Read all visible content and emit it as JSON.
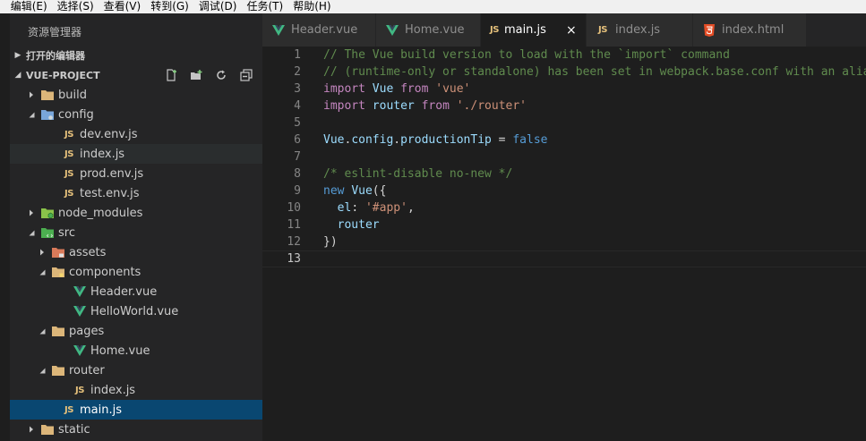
{
  "menu": {
    "items": [
      "编辑(E)",
      "选择(S)",
      "查看(V)",
      "转到(G)",
      "调试(D)",
      "任务(T)",
      "帮助(H)"
    ],
    "leading": ")"
  },
  "sidebar": {
    "title": "资源管理器",
    "open_editors_label": "打开的编辑器",
    "project_label": "VUE-PROJECT",
    "actions": [
      "new-file-icon",
      "new-folder-icon",
      "refresh-icon",
      "collapse-all-icon"
    ],
    "tree": [
      {
        "label": "build",
        "type": "folder",
        "depth": 0,
        "expanded": false
      },
      {
        "label": "config",
        "type": "folder-config",
        "depth": 0,
        "expanded": true
      },
      {
        "label": "dev.env.js",
        "type": "js",
        "depth": 1
      },
      {
        "label": "index.js",
        "type": "js",
        "depth": 1,
        "hover": true
      },
      {
        "label": "prod.env.js",
        "type": "js",
        "depth": 1
      },
      {
        "label": "test.env.js",
        "type": "js",
        "depth": 1
      },
      {
        "label": "node_modules",
        "type": "folder-node",
        "depth": 0,
        "expanded": false
      },
      {
        "label": "src",
        "type": "folder-src",
        "depth": 0,
        "expanded": true
      },
      {
        "label": "assets",
        "type": "folder-assets",
        "depth": 1,
        "expanded": false
      },
      {
        "label": "components",
        "type": "folder-components",
        "depth": 1,
        "expanded": true
      },
      {
        "label": "Header.vue",
        "type": "vue",
        "depth": 2
      },
      {
        "label": "HelloWorld.vue",
        "type": "vue",
        "depth": 2
      },
      {
        "label": "pages",
        "type": "folder-plain",
        "depth": 1,
        "expanded": true
      },
      {
        "label": "Home.vue",
        "type": "vue",
        "depth": 2
      },
      {
        "label": "router",
        "type": "folder-plain",
        "depth": 1,
        "expanded": true
      },
      {
        "label": "index.js",
        "type": "js",
        "depth": 2
      },
      {
        "label": "main.js",
        "type": "js",
        "depth": 1,
        "selected": true
      },
      {
        "label": "static",
        "type": "folder-plain",
        "depth": 0,
        "expanded": false
      }
    ]
  },
  "tabs": [
    {
      "label": "Header.vue",
      "type": "vue",
      "active": false
    },
    {
      "label": "Home.vue",
      "type": "vue",
      "active": false
    },
    {
      "label": "main.js",
      "type": "js",
      "active": true,
      "close": "×"
    },
    {
      "label": "index.js",
      "type": "js",
      "active": false
    },
    {
      "label": "index.html",
      "type": "html",
      "active": false
    }
  ],
  "editor": {
    "current_line": 13,
    "lines": [
      {
        "n": "1",
        "tokens": [
          [
            "c-comment",
            "// The Vue build version to load with the `import` command"
          ]
        ]
      },
      {
        "n": "2",
        "tokens": [
          [
            "c-comment",
            "// (runtime-only or standalone) has been set in webpack.base.conf with an alias."
          ]
        ]
      },
      {
        "n": "3",
        "tokens": [
          [
            "c-import",
            "import"
          ],
          [
            "c-plain",
            " "
          ],
          [
            "c-ident",
            "Vue"
          ],
          [
            "c-plain",
            " "
          ],
          [
            "c-import",
            "from"
          ],
          [
            "c-plain",
            " "
          ],
          [
            "c-str",
            "'vue'"
          ]
        ]
      },
      {
        "n": "4",
        "tokens": [
          [
            "c-import",
            "import"
          ],
          [
            "c-plain",
            " "
          ],
          [
            "c-ident",
            "router"
          ],
          [
            "c-plain",
            " "
          ],
          [
            "c-import",
            "from"
          ],
          [
            "c-plain",
            " "
          ],
          [
            "c-str",
            "'./router'"
          ]
        ]
      },
      {
        "n": "5",
        "tokens": []
      },
      {
        "n": "6",
        "tokens": [
          [
            "c-ident",
            "Vue"
          ],
          [
            "c-plain",
            "."
          ],
          [
            "c-ident",
            "config"
          ],
          [
            "c-plain",
            "."
          ],
          [
            "c-ident",
            "productionTip"
          ],
          [
            "c-plain",
            " = "
          ],
          [
            "c-kw",
            "false"
          ]
        ]
      },
      {
        "n": "7",
        "tokens": []
      },
      {
        "n": "8",
        "tokens": [
          [
            "c-comment",
            "/* eslint-disable no-new */"
          ]
        ]
      },
      {
        "n": "9",
        "tokens": [
          [
            "c-kw",
            "new"
          ],
          [
            "c-plain",
            " "
          ],
          [
            "c-ident",
            "Vue"
          ],
          [
            "c-plain",
            "({"
          ]
        ]
      },
      {
        "n": "10",
        "tokens": [
          [
            "c-plain",
            "  "
          ],
          [
            "c-ident",
            "el"
          ],
          [
            "c-plain",
            ": "
          ],
          [
            "c-str",
            "'#app'"
          ],
          [
            "c-plain",
            ","
          ]
        ]
      },
      {
        "n": "11",
        "tokens": [
          [
            "c-plain",
            "  "
          ],
          [
            "c-ident",
            "router"
          ]
        ]
      },
      {
        "n": "12",
        "tokens": [
          [
            "c-plain",
            "})"
          ]
        ]
      },
      {
        "n": "13",
        "tokens": []
      }
    ]
  },
  "colors": {
    "selected_row": "#094771",
    "vue_green": "#41b883",
    "js_yellow": "#e5c07b",
    "html_orange": "#e44d26"
  }
}
